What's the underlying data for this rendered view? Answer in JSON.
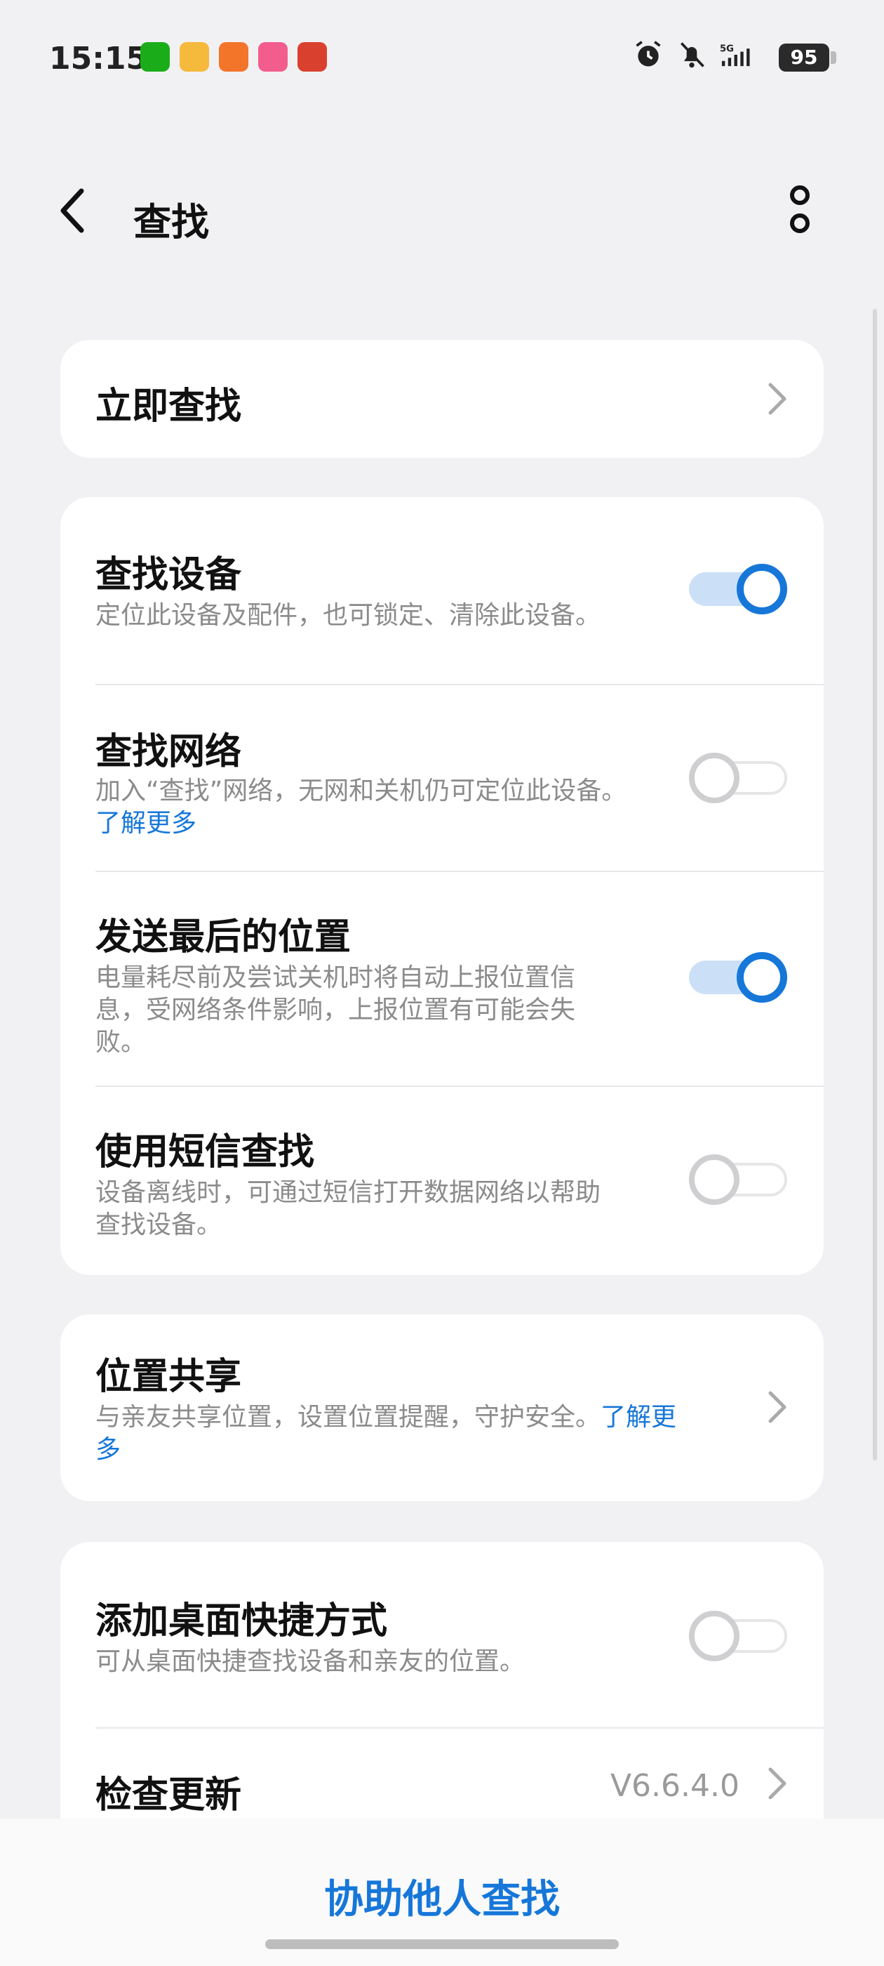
{
  "status_bar": {
    "time": "15:15",
    "apps": [
      "wechat-icon",
      "weibo-icon",
      "app-orange-icon",
      "bilibili-icon",
      "game-app-icon"
    ],
    "battery": "95",
    "network": "5G"
  },
  "header": {
    "title": "查找"
  },
  "find_now": {
    "title": "立即查找"
  },
  "settings": [
    {
      "title": "查找设备",
      "subtitle": "定位此设备及配件，也可锁定、清除此设备。",
      "enabled": true
    },
    {
      "title": "查找网络",
      "subtitle": "加入“查找”网络，无网和关机仍可定位此设备。",
      "link": "了解更多",
      "enabled": false
    },
    {
      "title": "发送最后的位置",
      "subtitle_lines": [
        "电量耗尽前及尝试关机时将自动上报位置信",
        "息，受网络条件影响，上报位置有可能会失",
        "败。"
      ],
      "enabled": true
    },
    {
      "title": "使用短信查找",
      "subtitle_lines": [
        "设备离线时，可通过短信打开数据网络以帮助",
        "查找设备。"
      ],
      "enabled": false
    }
  ],
  "location_share": {
    "title": "位置共享",
    "subtitle": "与亲友共享位置，设置位置提醒，守护安全。",
    "link_part1": "了解更",
    "link_part2": "多"
  },
  "shortcut": {
    "title": "添加桌面快捷方式",
    "subtitle": "可从桌面快捷查找设备和亲友的位置。",
    "enabled": false
  },
  "update": {
    "title": "检查更新",
    "version": "V6.6.4.0"
  },
  "bottom": {
    "assist_label": "协助他人查找"
  },
  "colors": {
    "accent": "#1677D9",
    "background": "#F1F1F3"
  }
}
